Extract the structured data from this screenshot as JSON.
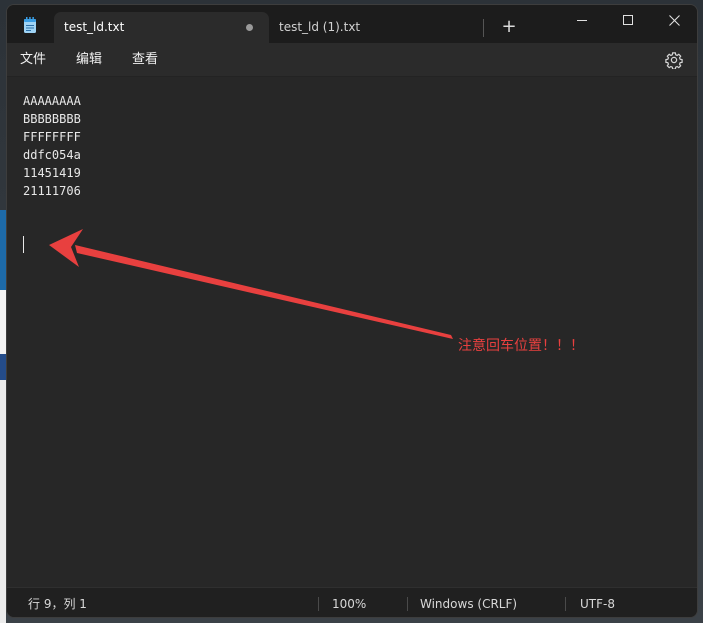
{
  "tabs": [
    {
      "label": "test_ld.txt",
      "active": true,
      "modified": true
    },
    {
      "label": "test_ld (1).txt",
      "active": false
    }
  ],
  "new_tab_label": "+",
  "menu": {
    "file": "文件",
    "edit": "编辑",
    "view": "查看"
  },
  "editor": {
    "lines": [
      "AAAAAAAA",
      "BBBBBBBB",
      "FFFFFFFF",
      "ddfc054a",
      "11451419",
      "21111706"
    ]
  },
  "annotation": {
    "text": "注意回车位置！！！",
    "color": "#e8403f"
  },
  "status": {
    "position": "行 9，列 1",
    "zoom": "100%",
    "line_ending": "Windows (CRLF)",
    "encoding": "UTF-8"
  },
  "icons": {
    "app": "notepad-icon",
    "settings": "gear-icon",
    "minimize": "minimize-icon",
    "maximize": "maximize-icon",
    "close": "close-icon"
  },
  "colors": {
    "editor_bg": "#272727",
    "titlebar_bg": "#1c1c1c",
    "accent": "#3a9ee4"
  }
}
